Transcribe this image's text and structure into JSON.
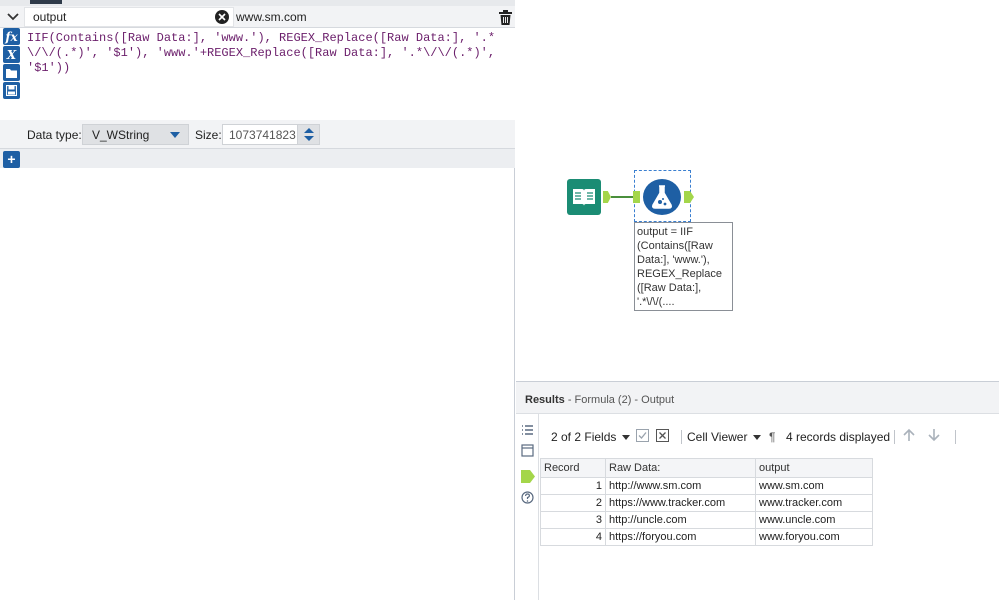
{
  "formula": {
    "field_name": "output",
    "preview_value": "www.sm.com",
    "expression": "IIF(Contains([Raw Data:], 'www.'), REGEX_Replace([Raw Data:], '.*\\/\\/(.*)', '$1'), 'www.'+REGEX_Replace([Raw Data:], '.*\\/\\/(.*)', '$1'))",
    "tools": [
      "fx",
      "X"
    ],
    "data_type_label": "Data type:",
    "data_type_value": "V_WString",
    "size_label": "Size:",
    "size_value": "1073741823",
    "add_label": "+"
  },
  "canvas": {
    "annotation": "output = IIF (Contains([Raw Data:], 'www.'), REGEX_Replace ([Raw Data:], '.*\\/\\/(...."
  },
  "results": {
    "title": "Results",
    "subtitle": "- Formula (2) - Output",
    "fields_label": "2 of 2 Fields",
    "viewer_label": "Cell Viewer",
    "records_label": "4 records displayed",
    "columns": [
      "Record",
      "Raw Data:",
      "output"
    ],
    "rows": [
      {
        "record": "1",
        "raw": "http://www.sm.com",
        "output": "www.sm.com"
      },
      {
        "record": "2",
        "raw": "https://www.tracker.com",
        "output": "www.tracker.com"
      },
      {
        "record": "3",
        "raw": "http://uncle.com",
        "output": "www.uncle.com"
      },
      {
        "record": "4",
        "raw": "https://foryou.com",
        "output": "www.foryou.com"
      }
    ]
  }
}
